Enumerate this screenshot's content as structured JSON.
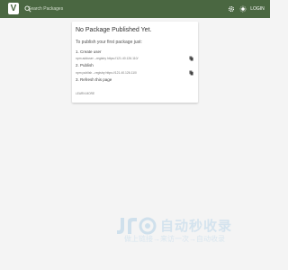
{
  "header": {
    "logo_letter": "V",
    "search_placeholder": "Search Packages",
    "login_label": "LOGIN",
    "icons": [
      "search-icon",
      "gear-icon",
      "theme-icon"
    ]
  },
  "empty_state": {
    "title": "No Package Published Yet.",
    "subtitle": "To publish your first package just:",
    "steps": [
      {
        "label": "1. Create user",
        "command": "npm adduser --registry https://121.40.126.110/"
      },
      {
        "label": "2. Publish",
        "command": "npm publish --registry https://121.40.126.110/"
      },
      {
        "label": "3. Refresh this page"
      }
    ],
    "learn_more": "LEARN MORE"
  },
  "watermark": {
    "brand": "自动秒收录",
    "tagline": "做上链接→来访一次→自动收录"
  },
  "colors": {
    "header_bg": "#4a6741",
    "page_bg": "#f4f4f4",
    "card_bg": "#ffffff"
  }
}
